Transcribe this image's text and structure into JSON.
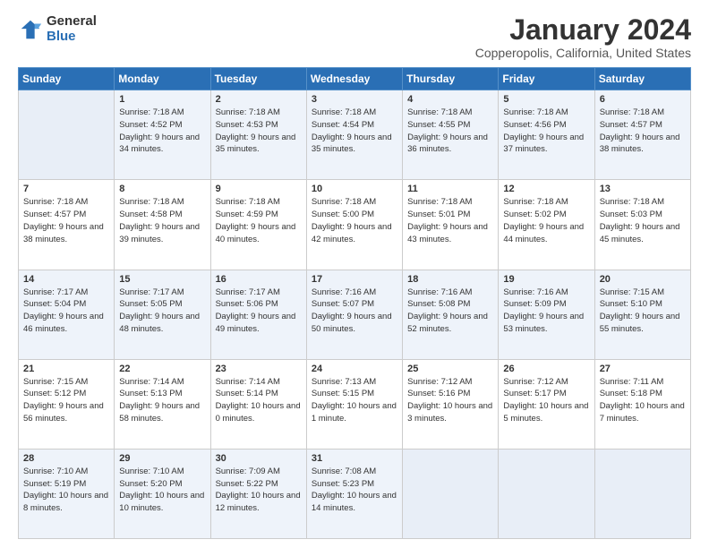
{
  "logo": {
    "general": "General",
    "blue": "Blue"
  },
  "title": "January 2024",
  "subtitle": "Copperopolis, California, United States",
  "weekdays": [
    "Sunday",
    "Monday",
    "Tuesday",
    "Wednesday",
    "Thursday",
    "Friday",
    "Saturday"
  ],
  "weeks": [
    [
      {
        "day": null,
        "info": null
      },
      {
        "day": "1",
        "sunrise": "Sunrise: 7:18 AM",
        "sunset": "Sunset: 4:52 PM",
        "daylight": "Daylight: 9 hours and 34 minutes."
      },
      {
        "day": "2",
        "sunrise": "Sunrise: 7:18 AM",
        "sunset": "Sunset: 4:53 PM",
        "daylight": "Daylight: 9 hours and 35 minutes."
      },
      {
        "day": "3",
        "sunrise": "Sunrise: 7:18 AM",
        "sunset": "Sunset: 4:54 PM",
        "daylight": "Daylight: 9 hours and 35 minutes."
      },
      {
        "day": "4",
        "sunrise": "Sunrise: 7:18 AM",
        "sunset": "Sunset: 4:55 PM",
        "daylight": "Daylight: 9 hours and 36 minutes."
      },
      {
        "day": "5",
        "sunrise": "Sunrise: 7:18 AM",
        "sunset": "Sunset: 4:56 PM",
        "daylight": "Daylight: 9 hours and 37 minutes."
      },
      {
        "day": "6",
        "sunrise": "Sunrise: 7:18 AM",
        "sunset": "Sunset: 4:57 PM",
        "daylight": "Daylight: 9 hours and 38 minutes."
      }
    ],
    [
      {
        "day": "7",
        "sunrise": "Sunrise: 7:18 AM",
        "sunset": "Sunset: 4:57 PM",
        "daylight": "Daylight: 9 hours and 38 minutes."
      },
      {
        "day": "8",
        "sunrise": "Sunrise: 7:18 AM",
        "sunset": "Sunset: 4:58 PM",
        "daylight": "Daylight: 9 hours and 39 minutes."
      },
      {
        "day": "9",
        "sunrise": "Sunrise: 7:18 AM",
        "sunset": "Sunset: 4:59 PM",
        "daylight": "Daylight: 9 hours and 40 minutes."
      },
      {
        "day": "10",
        "sunrise": "Sunrise: 7:18 AM",
        "sunset": "Sunset: 5:00 PM",
        "daylight": "Daylight: 9 hours and 42 minutes."
      },
      {
        "day": "11",
        "sunrise": "Sunrise: 7:18 AM",
        "sunset": "Sunset: 5:01 PM",
        "daylight": "Daylight: 9 hours and 43 minutes."
      },
      {
        "day": "12",
        "sunrise": "Sunrise: 7:18 AM",
        "sunset": "Sunset: 5:02 PM",
        "daylight": "Daylight: 9 hours and 44 minutes."
      },
      {
        "day": "13",
        "sunrise": "Sunrise: 7:18 AM",
        "sunset": "Sunset: 5:03 PM",
        "daylight": "Daylight: 9 hours and 45 minutes."
      }
    ],
    [
      {
        "day": "14",
        "sunrise": "Sunrise: 7:17 AM",
        "sunset": "Sunset: 5:04 PM",
        "daylight": "Daylight: 9 hours and 46 minutes."
      },
      {
        "day": "15",
        "sunrise": "Sunrise: 7:17 AM",
        "sunset": "Sunset: 5:05 PM",
        "daylight": "Daylight: 9 hours and 48 minutes."
      },
      {
        "day": "16",
        "sunrise": "Sunrise: 7:17 AM",
        "sunset": "Sunset: 5:06 PM",
        "daylight": "Daylight: 9 hours and 49 minutes."
      },
      {
        "day": "17",
        "sunrise": "Sunrise: 7:16 AM",
        "sunset": "Sunset: 5:07 PM",
        "daylight": "Daylight: 9 hours and 50 minutes."
      },
      {
        "day": "18",
        "sunrise": "Sunrise: 7:16 AM",
        "sunset": "Sunset: 5:08 PM",
        "daylight": "Daylight: 9 hours and 52 minutes."
      },
      {
        "day": "19",
        "sunrise": "Sunrise: 7:16 AM",
        "sunset": "Sunset: 5:09 PM",
        "daylight": "Daylight: 9 hours and 53 minutes."
      },
      {
        "day": "20",
        "sunrise": "Sunrise: 7:15 AM",
        "sunset": "Sunset: 5:10 PM",
        "daylight": "Daylight: 9 hours and 55 minutes."
      }
    ],
    [
      {
        "day": "21",
        "sunrise": "Sunrise: 7:15 AM",
        "sunset": "Sunset: 5:12 PM",
        "daylight": "Daylight: 9 hours and 56 minutes."
      },
      {
        "day": "22",
        "sunrise": "Sunrise: 7:14 AM",
        "sunset": "Sunset: 5:13 PM",
        "daylight": "Daylight: 9 hours and 58 minutes."
      },
      {
        "day": "23",
        "sunrise": "Sunrise: 7:14 AM",
        "sunset": "Sunset: 5:14 PM",
        "daylight": "Daylight: 10 hours and 0 minutes."
      },
      {
        "day": "24",
        "sunrise": "Sunrise: 7:13 AM",
        "sunset": "Sunset: 5:15 PM",
        "daylight": "Daylight: 10 hours and 1 minute."
      },
      {
        "day": "25",
        "sunrise": "Sunrise: 7:12 AM",
        "sunset": "Sunset: 5:16 PM",
        "daylight": "Daylight: 10 hours and 3 minutes."
      },
      {
        "day": "26",
        "sunrise": "Sunrise: 7:12 AM",
        "sunset": "Sunset: 5:17 PM",
        "daylight": "Daylight: 10 hours and 5 minutes."
      },
      {
        "day": "27",
        "sunrise": "Sunrise: 7:11 AM",
        "sunset": "Sunset: 5:18 PM",
        "daylight": "Daylight: 10 hours and 7 minutes."
      }
    ],
    [
      {
        "day": "28",
        "sunrise": "Sunrise: 7:10 AM",
        "sunset": "Sunset: 5:19 PM",
        "daylight": "Daylight: 10 hours and 8 minutes."
      },
      {
        "day": "29",
        "sunrise": "Sunrise: 7:10 AM",
        "sunset": "Sunset: 5:20 PM",
        "daylight": "Daylight: 10 hours and 10 minutes."
      },
      {
        "day": "30",
        "sunrise": "Sunrise: 7:09 AM",
        "sunset": "Sunset: 5:22 PM",
        "daylight": "Daylight: 10 hours and 12 minutes."
      },
      {
        "day": "31",
        "sunrise": "Sunrise: 7:08 AM",
        "sunset": "Sunset: 5:23 PM",
        "daylight": "Daylight: 10 hours and 14 minutes."
      },
      {
        "day": null,
        "info": null
      },
      {
        "day": null,
        "info": null
      },
      {
        "day": null,
        "info": null
      }
    ]
  ]
}
